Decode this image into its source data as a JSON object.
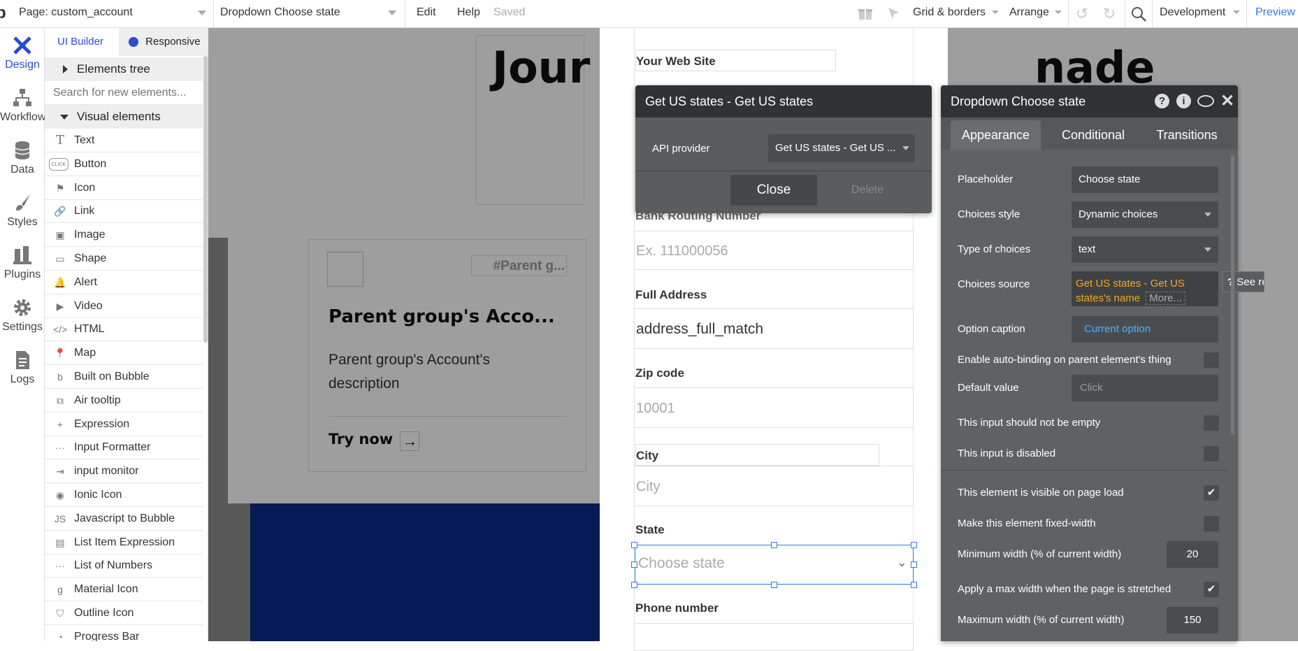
{
  "topbar": {
    "page_selector": "Page: custom_account",
    "element_selector": "Dropdown Choose state",
    "menu_edit": "Edit",
    "menu_help": "Help",
    "status": "Saved",
    "grid_borders": "Grid & borders",
    "arrange": "Arrange",
    "environment": "Development",
    "preview": "Preview"
  },
  "rail": {
    "items": [
      {
        "label": "Design",
        "icon": "design-icon",
        "active": true
      },
      {
        "label": "Workflow",
        "icon": "workflow-icon"
      },
      {
        "label": "Data",
        "icon": "database-icon"
      },
      {
        "label": "Styles",
        "icon": "brush-icon"
      },
      {
        "label": "Plugins",
        "icon": "plug-icon"
      },
      {
        "label": "Settings",
        "icon": "gear-icon"
      },
      {
        "label": "Logs",
        "icon": "document-icon"
      }
    ]
  },
  "panel": {
    "tab_ui_builder": "UI Builder",
    "tab_responsive": "Responsive",
    "elements_tree": "Elements tree",
    "search_placeholder": "Search for new elements...",
    "visual_elements": "Visual elements",
    "items": [
      {
        "label": "Text",
        "icon": "T"
      },
      {
        "label": "Button",
        "icon": "CLICK"
      },
      {
        "label": "Icon",
        "icon": "⚑"
      },
      {
        "label": "Link",
        "icon": "🔗"
      },
      {
        "label": "Image",
        "icon": "▣"
      },
      {
        "label": "Shape",
        "icon": "▭"
      },
      {
        "label": "Alert",
        "icon": "🔔"
      },
      {
        "label": "Video",
        "icon": "▶"
      },
      {
        "label": "HTML",
        "icon": "</>"
      },
      {
        "label": "Map",
        "icon": "📍"
      },
      {
        "label": "Built on Bubble",
        "icon": "b"
      },
      {
        "label": "Air tooltip",
        "icon": "⧉"
      },
      {
        "label": "Expression",
        "icon": "+"
      },
      {
        "label": "Input Formatter",
        "icon": "···"
      },
      {
        "label": "input monitor",
        "icon": "⇥"
      },
      {
        "label": "Ionic Icon",
        "icon": "◉"
      },
      {
        "label": "Javascript to Bubble",
        "icon": "JS"
      },
      {
        "label": "List Item Expression",
        "icon": "▤"
      },
      {
        "label": "List of Numbers",
        "icon": "···"
      },
      {
        "label": "Material Icon",
        "icon": "g"
      },
      {
        "label": "Outline Icon",
        "icon": "⛉"
      },
      {
        "label": "Progress Bar",
        "icon": "◔"
      }
    ]
  },
  "canvas": {
    "hero_text_left": "Jour",
    "hero_text_right": "nade",
    "parent_tag": "#Parent g...",
    "card_title": "Parent group's Acco...",
    "card_description": "Parent group's Account's description",
    "try_now": "Try now",
    "form": {
      "website_label": "Your Web Site",
      "bank_label": "Bank Routing Number",
      "bank_placeholder": "Ex. 111000056",
      "address_label": "Full Address",
      "address_value": "address_full_match",
      "zip_label": "Zip code",
      "zip_placeholder": "10001",
      "city_label": "City",
      "city_placeholder": "City",
      "state_label": "State",
      "state_placeholder": "Choose state",
      "phone_label": "Phone number"
    }
  },
  "api_window": {
    "title": "Get US states - Get US states",
    "provider_label": "API provider",
    "provider_value": "Get US states - Get US ...",
    "close": "Close",
    "delete": "Delete"
  },
  "property_editor": {
    "title": "Dropdown Choose state",
    "tabs": [
      "Appearance",
      "Conditional",
      "Transitions"
    ],
    "placeholder_label": "Placeholder",
    "placeholder_value": "Choose state",
    "choices_style_label": "Choices style",
    "choices_style_value": "Dynamic choices",
    "type_label": "Type of choices",
    "type_value": "text",
    "source_label": "Choices source",
    "source_value": "Get US states - Get US states's name",
    "source_more": "More...",
    "see_reference": "See reference",
    "option_caption_label": "Option caption",
    "option_caption_value": "Current option",
    "autobinding_label": "Enable auto-binding on parent element's thing",
    "default_label": "Default value",
    "default_value": "Click",
    "not_empty_label": "This input should not be empty",
    "disabled_label": "This input is disabled",
    "visible_label": "This element is visible on page load",
    "fixed_width_label": "Make this element fixed-width",
    "min_width_label": "Minimum width (% of current width)",
    "min_width_value": "20",
    "max_width_apply_label": "Apply a max width when the page is stretched",
    "max_width_label": "Maximum width (% of current width)",
    "max_width_value": "150",
    "checkmark": "✔"
  },
  "colors": {
    "accent": "#2a7de1",
    "orange": "#f5a623",
    "dark_header": "#2f3336",
    "panel_bg": "#5a5c5e",
    "navy": "#0a2a8a"
  }
}
